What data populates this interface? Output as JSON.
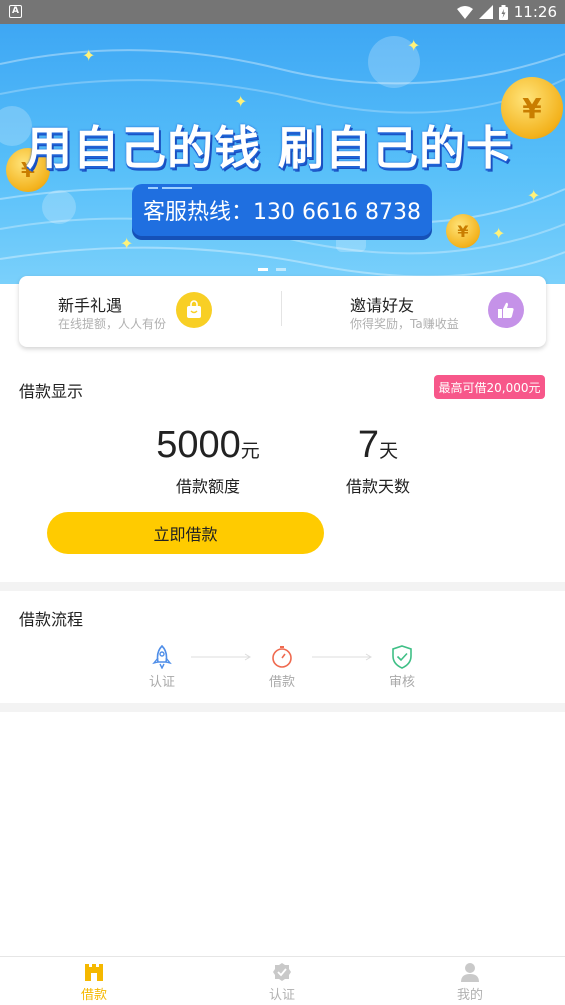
{
  "status_bar": {
    "time": "11:26"
  },
  "banner": {
    "headline": "用自己的钱  刷自己的卡",
    "hotline": "客服热线：130 6616 8738"
  },
  "promo": {
    "left": {
      "title": "新手礼遇",
      "subtitle": "在线提额，人人有份",
      "icon": "shopping-bag-icon"
    },
    "right": {
      "title": "邀请好友",
      "subtitle": "你得奖励，Ta赚收益",
      "icon": "thumbs-up-icon"
    }
  },
  "loan": {
    "section_title": "借款显示",
    "max_badge": "最高可借20,000元",
    "amount_value": "5000",
    "amount_unit": "元",
    "amount_label": "借款额度",
    "days_value": "7",
    "days_unit": "天",
    "days_label": "借款天数",
    "button_label": "立即借款"
  },
  "process": {
    "section_title": "借款流程",
    "steps": [
      {
        "label": "认证",
        "icon": "rocket-icon"
      },
      {
        "label": "借款",
        "icon": "stopwatch-icon"
      },
      {
        "label": "审核",
        "icon": "shield-check-icon"
      }
    ]
  },
  "bottom_nav": [
    {
      "label": "借款",
      "icon": "castle-icon",
      "active": true
    },
    {
      "label": "认证",
      "icon": "verified-badge-icon",
      "active": false
    },
    {
      "label": "我的",
      "icon": "person-icon",
      "active": false
    }
  ],
  "colors": {
    "accent": "#ffcb00",
    "badge": "#f7578a",
    "banner": "#3ea7f4"
  }
}
